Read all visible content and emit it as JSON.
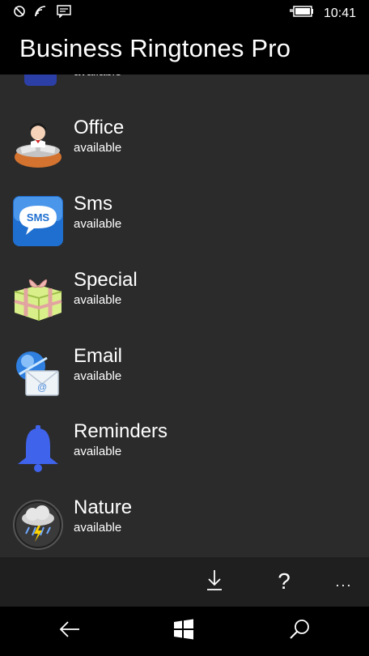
{
  "status_bar": {
    "time": "10:41",
    "icons": [
      "quiet-hours-icon",
      "wifi-icon",
      "message-icon",
      "battery-charging-icon"
    ]
  },
  "app": {
    "title": "Business Ringtones Pro"
  },
  "list": {
    "items": [
      {
        "name": "",
        "status": "available",
        "icon": "partial-category-icon"
      },
      {
        "name": "Office",
        "status": "available",
        "icon": "office-icon"
      },
      {
        "name": "Sms",
        "status": "available",
        "icon": "sms-icon"
      },
      {
        "name": "Special",
        "status": "available",
        "icon": "gift-icon"
      },
      {
        "name": "Email",
        "status": "available",
        "icon": "email-icon"
      },
      {
        "name": "Reminders",
        "status": "available",
        "icon": "bell-icon"
      },
      {
        "name": "Nature",
        "status": "available",
        "icon": "storm-cloud-icon"
      }
    ]
  },
  "app_bar": {
    "buttons": [
      "download-icon",
      "help-icon",
      "more-icon"
    ],
    "help_glyph": "?",
    "more_glyph": "..."
  },
  "nav_bar": {
    "buttons": [
      "back-icon",
      "windows-icon",
      "search-icon"
    ]
  },
  "colors": {
    "list_bg": "#2b2b2b",
    "app_bar_bg": "#1f1f1f",
    "bell": "#3f63ea",
    "sms": "#1f6fd0"
  }
}
